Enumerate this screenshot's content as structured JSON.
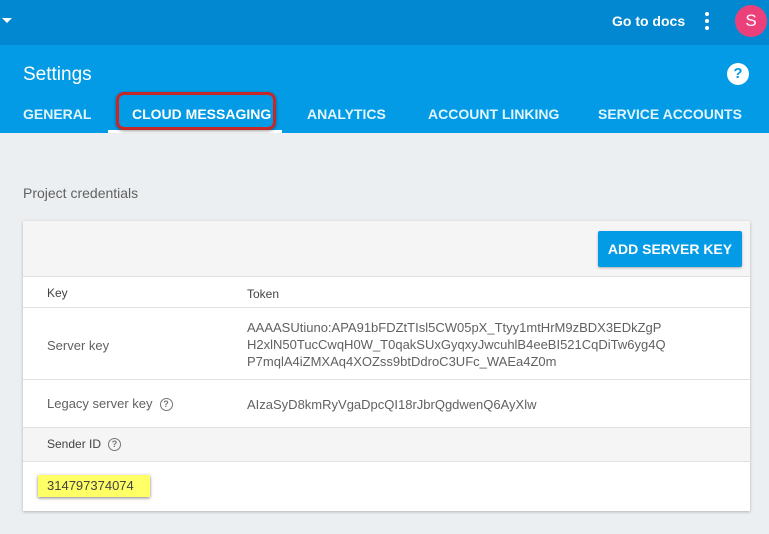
{
  "topbar": {
    "docs_label": "Go to docs",
    "avatar_letter": "S"
  },
  "header": {
    "title": "Settings",
    "help": "?"
  },
  "tabs": [
    {
      "label": "GENERAL"
    },
    {
      "label": "CLOUD MESSAGING"
    },
    {
      "label": "ANALYTICS"
    },
    {
      "label": "ACCOUNT LINKING"
    },
    {
      "label": "SERVICE ACCOUNTS"
    }
  ],
  "active_tab": "CLOUD MESSAGING",
  "credentials": {
    "section_title": "Project credentials",
    "add_button": "ADD SERVER KEY",
    "columns": {
      "key": "Key",
      "token": "Token"
    },
    "rows": [
      {
        "key": "Server key",
        "token": "AAAASUtiuno:APA91bFDZtTIsl5CW05pX_Ttyy1mtHrM9zBDX3EDkZgPH2xlN50TucCwqH0W_T0qakSUxGyqxyJwcuhlB4eeBI521CqDiTw6yg4QP7mqlA4iZMXAq4XOZss9btDdroC3UFc_WAEa4Z0m"
      },
      {
        "key": "Legacy server key",
        "token": "AIzaSyD8kmRyVgaDpcQI18rJbrQgdwenQ6AyXlw"
      }
    ],
    "sender_label": "Sender ID",
    "sender_value": "314797374074"
  },
  "colors": {
    "topbar": "#0288d1",
    "header": "#039be5",
    "highlight_border": "#c62828",
    "sender_highlight": "#ffff66",
    "avatar": "#ec407a"
  },
  "icons": [
    "dropdown-arrow-icon",
    "more-vert-icon",
    "help-circle-icon",
    "question-icon"
  ]
}
